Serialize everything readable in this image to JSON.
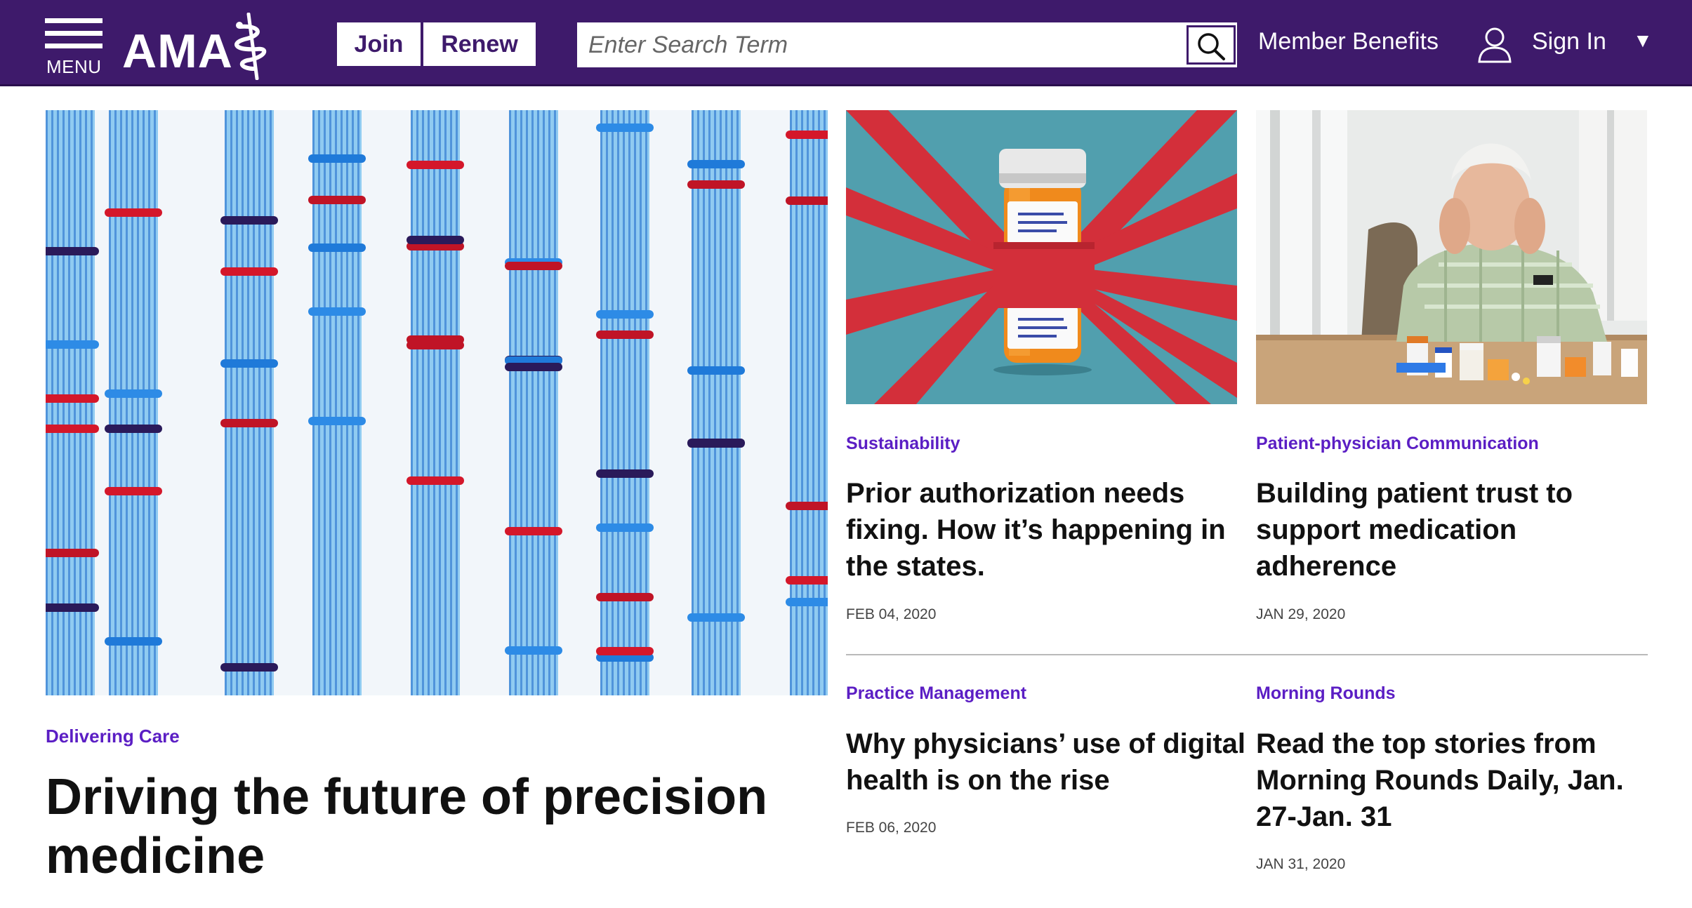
{
  "header": {
    "menu_label": "MENU",
    "logo_text": "AMA",
    "join_label": "Join",
    "renew_label": "Renew",
    "search_placeholder": "Enter Search Term",
    "member_benefits_label": "Member Benefits",
    "sign_in_label": "Sign In",
    "brand_color": "#3e1a6b"
  },
  "feature": {
    "category": "Delivering Care",
    "title": "Driving the future of precision medicine",
    "image": "dna-sequencing-gel-image"
  },
  "cards": [
    {
      "category": "Sustainability",
      "title": "Prior authorization needs fixing. How it’s happening in the states.",
      "date": "FEB 04, 2020",
      "image": "pill-bottle-red-tape-illustration"
    },
    {
      "category": "Patient-physician Communication",
      "title": "Building patient trust to support medication adherence",
      "date": "JAN 29, 2020",
      "image": "elderly-man-with-medications-photo"
    },
    {
      "category": "Practice Management",
      "title": "Why physicians’ use of digital health is on the rise",
      "date": "FEB 06, 2020"
    },
    {
      "category": "Morning Rounds",
      "title": "Read the top stories from Morning Rounds Daily, Jan. 27-Jan. 31",
      "date": "JAN 31, 2020"
    }
  ],
  "colors": {
    "category": "#5b1ec4",
    "title": "#111111",
    "divider": "#b9b9b9"
  }
}
